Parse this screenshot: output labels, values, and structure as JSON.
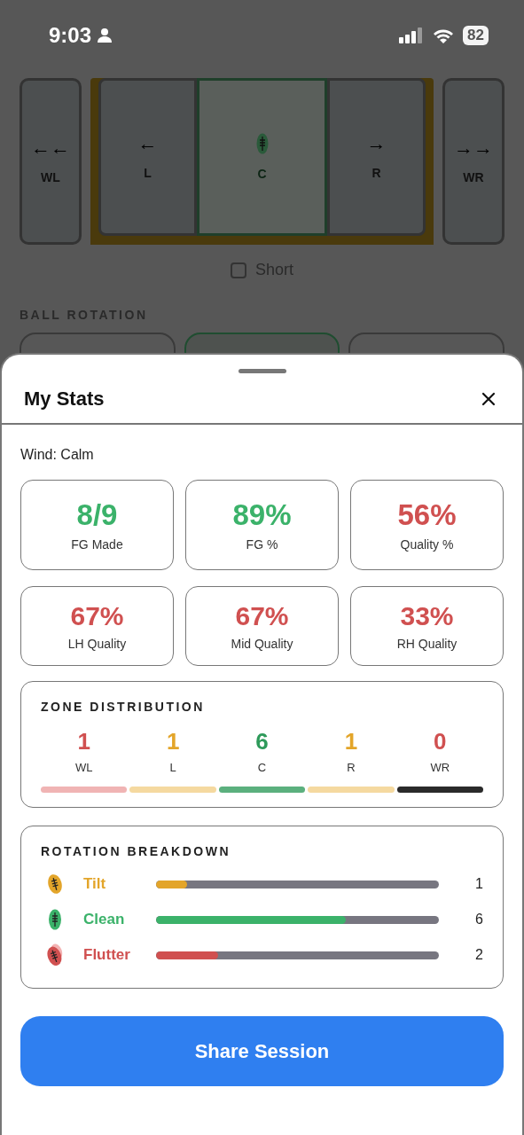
{
  "status_bar": {
    "time": "9:03",
    "battery": "82"
  },
  "zones": [
    {
      "kind": "wide",
      "label": "WL",
      "arrow": "←←",
      "selected": false
    },
    {
      "kind": "inner",
      "label": "L",
      "arrow": "←",
      "selected": false
    },
    {
      "kind": "inner",
      "label": "C",
      "selected": true
    },
    {
      "kind": "inner",
      "label": "R",
      "arrow": "→",
      "selected": false
    },
    {
      "kind": "wide",
      "label": "WR",
      "arrow": "→→",
      "selected": false
    }
  ],
  "short": {
    "label": "Short",
    "checked": false
  },
  "ball_rotation": {
    "title": "BALL ROTATION",
    "options": [
      {
        "selected": false
      },
      {
        "selected": true
      },
      {
        "selected": false
      }
    ]
  },
  "sheet": {
    "title": "My Stats",
    "wind": "Wind: Calm",
    "stats": [
      {
        "value": "8/9",
        "label": "FG Made",
        "color": "#3bb26a"
      },
      {
        "value": "89%",
        "label": "FG %",
        "color": "#3bb26a"
      },
      {
        "value": "56%",
        "label": "Quality %",
        "color": "#d05050"
      },
      {
        "value": "67%",
        "label": "LH Quality",
        "color": "#d05050"
      },
      {
        "value": "67%",
        "label": "Mid Quality",
        "color": "#d05050"
      },
      {
        "value": "33%",
        "label": "RH Quality",
        "color": "#d05050"
      }
    ],
    "zone_distribution": {
      "title": "ZONE DISTRIBUTION",
      "zones": [
        {
          "kind": "wide",
          "count": "1",
          "label": "WL",
          "color": "#d05050"
        },
        {
          "kind": "near",
          "count": "1",
          "label": "L",
          "color": "#e3a52a"
        },
        {
          "kind": "center",
          "count": "6",
          "label": "C",
          "color": "#2e9a5a"
        },
        {
          "kind": "near",
          "count": "1",
          "label": "R",
          "color": "#e3a52a"
        },
        {
          "kind": "empty",
          "count": "0",
          "label": "WR",
          "color": "#d05050"
        }
      ]
    },
    "rotation_breakdown": {
      "title": "ROTATION BREAKDOWN",
      "rows": [
        {
          "kind": "tilt",
          "label": "Tilt",
          "count": "1",
          "level": 0.11,
          "color": "#e3a52a"
        },
        {
          "kind": "clean",
          "label": "Clean",
          "count": "6",
          "level": 0.67,
          "color": "#3bb26a"
        },
        {
          "kind": "flutter",
          "label": "Flutter",
          "count": "2",
          "level": 0.22,
          "color": "#d05050"
        }
      ]
    },
    "share_button": "Share Session"
  }
}
